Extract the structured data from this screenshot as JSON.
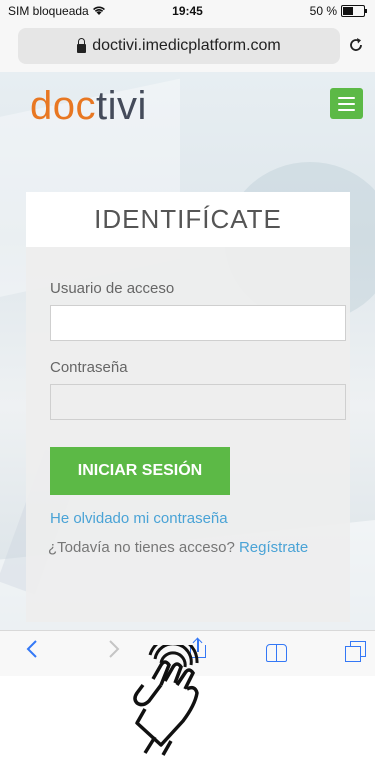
{
  "status_bar": {
    "carrier": "SIM bloqueada",
    "time": "19:45",
    "battery": "50 %",
    "battery_level": 0.5
  },
  "browser": {
    "url": "doctivi.imedicplatform.com"
  },
  "site": {
    "logo_part1": "doc",
    "logo_part2": "tivi",
    "login": {
      "title": "IDENTIFÍCATE",
      "username_label": "Usuario de acceso",
      "username_value": "",
      "password_label": "Contraseña",
      "password_value": "",
      "submit_label": "INICIAR SESIÓN",
      "forgot_link": "He olvidado mi contraseña",
      "no_access_text": "¿Todavía no tienes acceso?",
      "register_link": "Regístrate"
    }
  },
  "colors": {
    "brand_orange": "#e87722",
    "brand_green": "#5cb946",
    "link_blue": "#4aa3d6",
    "ios_blue": "#3478f6"
  },
  "icons": [
    "wifi-icon",
    "battery-icon",
    "lock-icon",
    "reload-icon",
    "menu-icon",
    "back-icon",
    "forward-icon",
    "share-icon",
    "bookmarks-icon",
    "tabs-icon",
    "tap-hand-icon"
  ]
}
